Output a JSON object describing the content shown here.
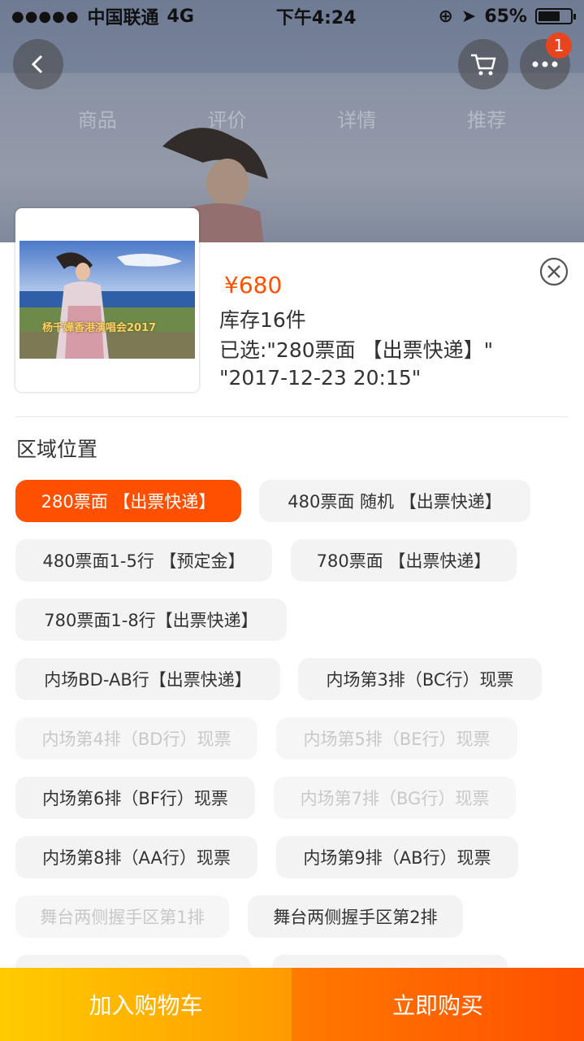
{
  "status": {
    "carrier": "中国联通",
    "network": "4G",
    "time": "下午4:24",
    "battery": "65%"
  },
  "hero_tabs": [
    "商品",
    "评价",
    "详情",
    "推荐"
  ],
  "cart_badge": "1",
  "product": {
    "thumb_caption": "杨千嬅香港演唱会2017",
    "price": "¥680",
    "stock": "库存16件",
    "selected_line1": "已选:\"280票面 【出票快递】\"",
    "selected_line2": "\"2017-12-23 20:15\""
  },
  "section_title": "区域位置",
  "options": [
    {
      "label": "280票面 【出票快递】",
      "state": "active"
    },
    {
      "label": "480票面 随机 【出票快递】",
      "state": "normal"
    },
    {
      "label": "480票面1-5行 【预定金】",
      "state": "normal"
    },
    {
      "label": "780票面 【出票快递】",
      "state": "normal"
    },
    {
      "label": "780票面1-8行【出票快递】",
      "state": "normal"
    },
    {
      "label": "内场BD-AB行【出票快递】",
      "state": "normal"
    },
    {
      "label": "内场第3排（BC行）现票",
      "state": "normal"
    },
    {
      "label": "内场第4排（BD行）现票",
      "state": "disabled"
    },
    {
      "label": "内场第5排（BE行）现票",
      "state": "disabled"
    },
    {
      "label": "内场第6排（BF行）现票",
      "state": "normal"
    },
    {
      "label": "内场第7排（BG行）现票",
      "state": "disabled"
    },
    {
      "label": "内场第8排（AA行）现票",
      "state": "normal"
    },
    {
      "label": "内场第9排（AB行）现票",
      "state": "normal"
    },
    {
      "label": "舞台两侧握手区第1排",
      "state": "disabled"
    },
    {
      "label": "舞台两侧握手区第2排",
      "state": "normal"
    }
  ],
  "buttons": {
    "add_to_cart": "加入购物车",
    "buy_now": "立即购买"
  },
  "colors": {
    "accent": "#ff5000",
    "cart_button": "#ffb300",
    "buy_button": "#ff6400"
  }
}
